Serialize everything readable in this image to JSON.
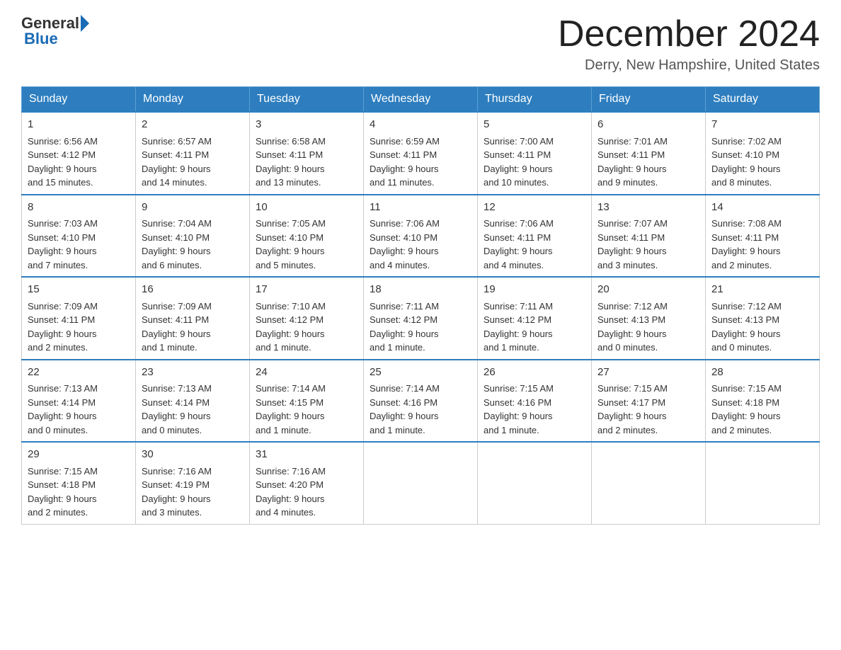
{
  "header": {
    "logo_general": "General",
    "logo_blue": "Blue",
    "month_title": "December 2024",
    "location": "Derry, New Hampshire, United States"
  },
  "weekdays": [
    "Sunday",
    "Monday",
    "Tuesday",
    "Wednesday",
    "Thursday",
    "Friday",
    "Saturday"
  ],
  "weeks": [
    [
      {
        "day": "1",
        "sunrise": "6:56 AM",
        "sunset": "4:12 PM",
        "daylight": "9 hours and 15 minutes."
      },
      {
        "day": "2",
        "sunrise": "6:57 AM",
        "sunset": "4:11 PM",
        "daylight": "9 hours and 14 minutes."
      },
      {
        "day": "3",
        "sunrise": "6:58 AM",
        "sunset": "4:11 PM",
        "daylight": "9 hours and 13 minutes."
      },
      {
        "day": "4",
        "sunrise": "6:59 AM",
        "sunset": "4:11 PM",
        "daylight": "9 hours and 11 minutes."
      },
      {
        "day": "5",
        "sunrise": "7:00 AM",
        "sunset": "4:11 PM",
        "daylight": "9 hours and 10 minutes."
      },
      {
        "day": "6",
        "sunrise": "7:01 AM",
        "sunset": "4:11 PM",
        "daylight": "9 hours and 9 minutes."
      },
      {
        "day": "7",
        "sunrise": "7:02 AM",
        "sunset": "4:10 PM",
        "daylight": "9 hours and 8 minutes."
      }
    ],
    [
      {
        "day": "8",
        "sunrise": "7:03 AM",
        "sunset": "4:10 PM",
        "daylight": "9 hours and 7 minutes."
      },
      {
        "day": "9",
        "sunrise": "7:04 AM",
        "sunset": "4:10 PM",
        "daylight": "9 hours and 6 minutes."
      },
      {
        "day": "10",
        "sunrise": "7:05 AM",
        "sunset": "4:10 PM",
        "daylight": "9 hours and 5 minutes."
      },
      {
        "day": "11",
        "sunrise": "7:06 AM",
        "sunset": "4:10 PM",
        "daylight": "9 hours and 4 minutes."
      },
      {
        "day": "12",
        "sunrise": "7:06 AM",
        "sunset": "4:11 PM",
        "daylight": "9 hours and 4 minutes."
      },
      {
        "day": "13",
        "sunrise": "7:07 AM",
        "sunset": "4:11 PM",
        "daylight": "9 hours and 3 minutes."
      },
      {
        "day": "14",
        "sunrise": "7:08 AM",
        "sunset": "4:11 PM",
        "daylight": "9 hours and 2 minutes."
      }
    ],
    [
      {
        "day": "15",
        "sunrise": "7:09 AM",
        "sunset": "4:11 PM",
        "daylight": "9 hours and 2 minutes."
      },
      {
        "day": "16",
        "sunrise": "7:09 AM",
        "sunset": "4:11 PM",
        "daylight": "9 hours and 1 minute."
      },
      {
        "day": "17",
        "sunrise": "7:10 AM",
        "sunset": "4:12 PM",
        "daylight": "9 hours and 1 minute."
      },
      {
        "day": "18",
        "sunrise": "7:11 AM",
        "sunset": "4:12 PM",
        "daylight": "9 hours and 1 minute."
      },
      {
        "day": "19",
        "sunrise": "7:11 AM",
        "sunset": "4:12 PM",
        "daylight": "9 hours and 1 minute."
      },
      {
        "day": "20",
        "sunrise": "7:12 AM",
        "sunset": "4:13 PM",
        "daylight": "9 hours and 0 minutes."
      },
      {
        "day": "21",
        "sunrise": "7:12 AM",
        "sunset": "4:13 PM",
        "daylight": "9 hours and 0 minutes."
      }
    ],
    [
      {
        "day": "22",
        "sunrise": "7:13 AM",
        "sunset": "4:14 PM",
        "daylight": "9 hours and 0 minutes."
      },
      {
        "day": "23",
        "sunrise": "7:13 AM",
        "sunset": "4:14 PM",
        "daylight": "9 hours and 0 minutes."
      },
      {
        "day": "24",
        "sunrise": "7:14 AM",
        "sunset": "4:15 PM",
        "daylight": "9 hours and 1 minute."
      },
      {
        "day": "25",
        "sunrise": "7:14 AM",
        "sunset": "4:16 PM",
        "daylight": "9 hours and 1 minute."
      },
      {
        "day": "26",
        "sunrise": "7:15 AM",
        "sunset": "4:16 PM",
        "daylight": "9 hours and 1 minute."
      },
      {
        "day": "27",
        "sunrise": "7:15 AM",
        "sunset": "4:17 PM",
        "daylight": "9 hours and 2 minutes."
      },
      {
        "day": "28",
        "sunrise": "7:15 AM",
        "sunset": "4:18 PM",
        "daylight": "9 hours and 2 minutes."
      }
    ],
    [
      {
        "day": "29",
        "sunrise": "7:15 AM",
        "sunset": "4:18 PM",
        "daylight": "9 hours and 2 minutes."
      },
      {
        "day": "30",
        "sunrise": "7:16 AM",
        "sunset": "4:19 PM",
        "daylight": "9 hours and 3 minutes."
      },
      {
        "day": "31",
        "sunrise": "7:16 AM",
        "sunset": "4:20 PM",
        "daylight": "9 hours and 4 minutes."
      },
      null,
      null,
      null,
      null
    ]
  ],
  "labels": {
    "sunrise": "Sunrise:",
    "sunset": "Sunset:",
    "daylight": "Daylight:"
  }
}
